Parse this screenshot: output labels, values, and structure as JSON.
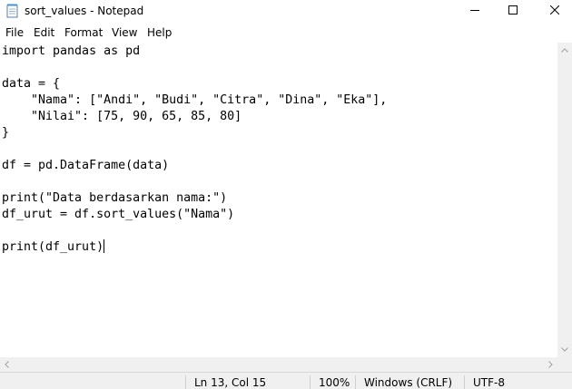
{
  "window": {
    "title": "sort_values - Notepad",
    "icon": "notepad-icon",
    "controls": [
      "minimize-icon",
      "maximize-icon",
      "close-icon"
    ]
  },
  "menu": {
    "file": "File",
    "edit": "Edit",
    "format": "Format",
    "view": "View",
    "help": "Help"
  },
  "editor": {
    "lines": [
      "import pandas as pd",
      "",
      "data = {",
      "    \"Nama\": [\"Andi\", \"Budi\", \"Citra\", \"Dina\", \"Eka\"],",
      "    \"Nilai\": [75, 90, 65, 85, 80]",
      "}",
      "",
      "df = pd.DataFrame(data)",
      "",
      "print(\"Data berdasarkan nama:\")",
      "df_urut = df.sort_values(\"Nama\")",
      "",
      "print(df_urut)"
    ]
  },
  "status": {
    "position": "Ln 13, Col 15",
    "zoom": "100%",
    "line_ending": "Windows (CRLF)",
    "encoding": "UTF-8"
  }
}
